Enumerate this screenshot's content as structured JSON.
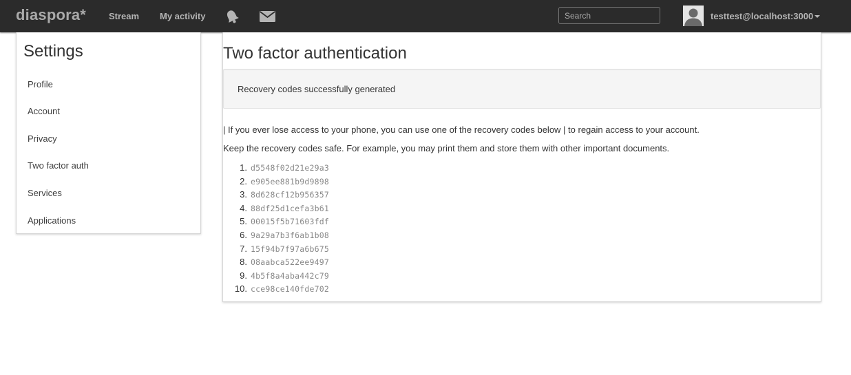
{
  "header": {
    "brand": "diaspora*",
    "nav": {
      "stream": "Stream",
      "my_activity": "My activity"
    },
    "icons": {
      "notifications": "bell-icon",
      "conversations": "mail-icon"
    },
    "search": {
      "placeholder": "Search",
      "value": ""
    },
    "user": {
      "name": "testtest@localhost:3000",
      "avatar_icon": "user-silhouette-icon"
    }
  },
  "sidebar": {
    "title": "Settings",
    "items": [
      {
        "label": "Profile"
      },
      {
        "label": "Account"
      },
      {
        "label": "Privacy"
      },
      {
        "label": "Two factor auth"
      },
      {
        "label": "Services"
      },
      {
        "label": "Applications"
      }
    ]
  },
  "main": {
    "title": "Two factor authentication",
    "flash": "Recovery codes successfully generated",
    "paragraph_1": "| If you ever lose access to your phone, you can use one of the recovery codes below | to regain access to your account.",
    "paragraph_2": "Keep the recovery codes safe. For example, you may print them and store them with other important documents.",
    "recovery_codes": [
      {
        "num": "1.",
        "code": "d5548f02d21e29a3"
      },
      {
        "num": "2.",
        "code": "e905ee881b9d9898"
      },
      {
        "num": "3.",
        "code": "8d628cf12b956357"
      },
      {
        "num": "4.",
        "code": "88df25d1cefa3b61"
      },
      {
        "num": "5.",
        "code": "00015f5b71603fdf"
      },
      {
        "num": "6.",
        "code": "9a29a7b3f6ab1b08"
      },
      {
        "num": "7.",
        "code": "15f94b7f97a6b675"
      },
      {
        "num": "8.",
        "code": "08aabca522ee9497"
      },
      {
        "num": "9.",
        "code": "4b5f8a4aba442c79"
      },
      {
        "num": "10.",
        "code": "cce98ce140fde702"
      }
    ]
  },
  "colors": {
    "topbar": "#2b2b2b",
    "topbar_text": "#b5b5b5",
    "flash_bg": "#f5f5f5",
    "code_text": "#888888"
  }
}
